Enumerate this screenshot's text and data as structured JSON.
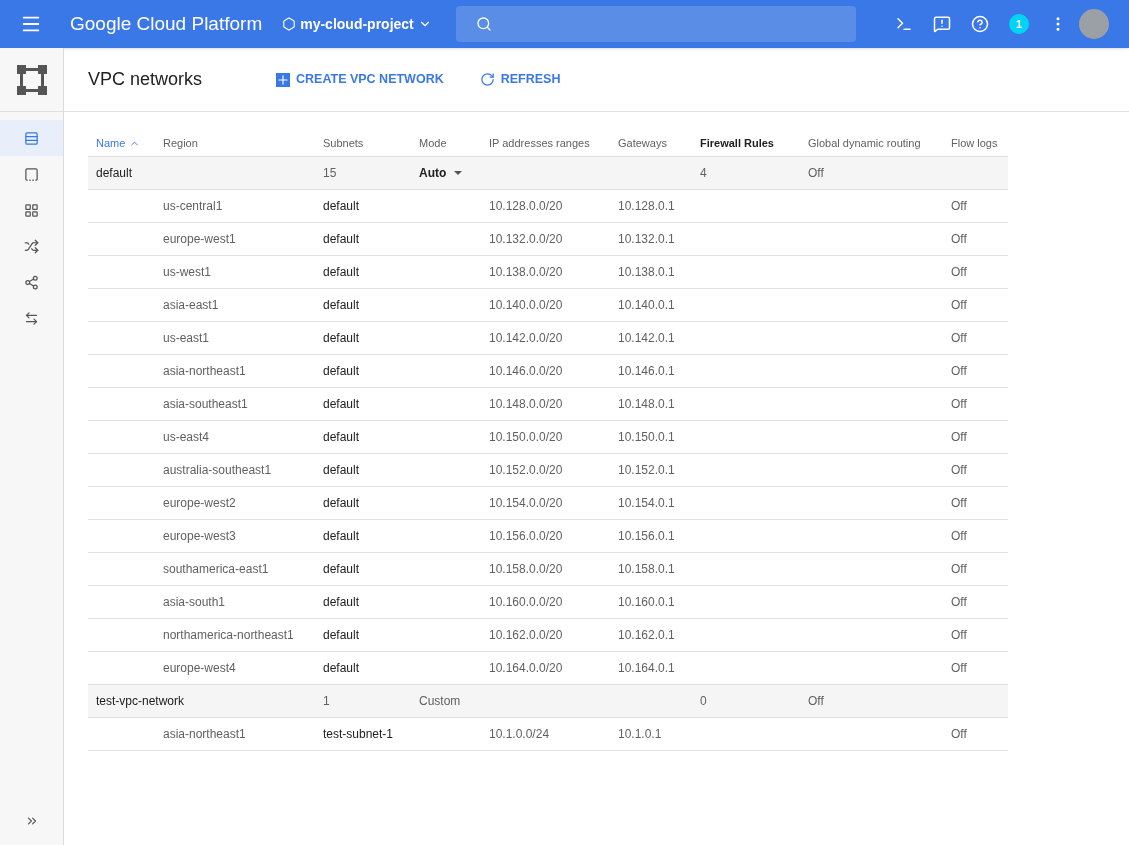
{
  "topbar": {
    "brand": "Google Cloud Platform",
    "project": "my-cloud-project",
    "notifications": "1"
  },
  "sidebar": {
    "items": [
      {
        "selected": true
      },
      {
        "selected": false
      },
      {
        "selected": false
      },
      {
        "selected": false
      },
      {
        "selected": false
      },
      {
        "selected": false
      }
    ]
  },
  "header": {
    "title": "VPC networks",
    "actions": [
      "CREATE VPC NETWORK",
      "REFRESH"
    ]
  },
  "table": {
    "columns": [
      {
        "label": "Name",
        "selected": true,
        "highlighted": false
      },
      {
        "label": "Region",
        "selected": false,
        "highlighted": false
      },
      {
        "label": "Subnets",
        "selected": false,
        "highlighted": false
      },
      {
        "label": "Mode",
        "selected": false,
        "highlighted": false
      },
      {
        "label": "IP addresses ranges",
        "selected": false,
        "highlighted": false
      },
      {
        "label": "Gateways",
        "selected": false,
        "highlighted": false
      },
      {
        "label": "Firewall Rules",
        "selected": false,
        "highlighted": true
      },
      {
        "label": "Global dynamic routing",
        "selected": false,
        "highlighted": false
      },
      {
        "label": "Flow logs",
        "selected": false,
        "highlighted": false
      }
    ],
    "networks": [
      {
        "name": "default",
        "subnets": "15",
        "mode": "Auto",
        "mode_dropdown": true,
        "firewall_rules": "4",
        "dynamic_routing": "Off",
        "children": [
          {
            "region": "us-central1",
            "subnet": "default",
            "ip_range": "10.128.0.0/20",
            "gateway": "10.128.0.1",
            "flow_logs": "Off"
          },
          {
            "region": "europe-west1",
            "subnet": "default",
            "ip_range": "10.132.0.0/20",
            "gateway": "10.132.0.1",
            "flow_logs": "Off"
          },
          {
            "region": "us-west1",
            "subnet": "default",
            "ip_range": "10.138.0.0/20",
            "gateway": "10.138.0.1",
            "flow_logs": "Off"
          },
          {
            "region": "asia-east1",
            "subnet": "default",
            "ip_range": "10.140.0.0/20",
            "gateway": "10.140.0.1",
            "flow_logs": "Off"
          },
          {
            "region": "us-east1",
            "subnet": "default",
            "ip_range": "10.142.0.0/20",
            "gateway": "10.142.0.1",
            "flow_logs": "Off"
          },
          {
            "region": "asia-northeast1",
            "subnet": "default",
            "ip_range": "10.146.0.0/20",
            "gateway": "10.146.0.1",
            "flow_logs": "Off"
          },
          {
            "region": "asia-southeast1",
            "subnet": "default",
            "ip_range": "10.148.0.0/20",
            "gateway": "10.148.0.1",
            "flow_logs": "Off"
          },
          {
            "region": "us-east4",
            "subnet": "default",
            "ip_range": "10.150.0.0/20",
            "gateway": "10.150.0.1",
            "flow_logs": "Off"
          },
          {
            "region": "australia-southeast1",
            "subnet": "default",
            "ip_range": "10.152.0.0/20",
            "gateway": "10.152.0.1",
            "flow_logs": "Off"
          },
          {
            "region": "europe-west2",
            "subnet": "default",
            "ip_range": "10.154.0.0/20",
            "gateway": "10.154.0.1",
            "flow_logs": "Off"
          },
          {
            "region": "europe-west3",
            "subnet": "default",
            "ip_range": "10.156.0.0/20",
            "gateway": "10.156.0.1",
            "flow_logs": "Off"
          },
          {
            "region": "southamerica-east1",
            "subnet": "default",
            "ip_range": "10.158.0.0/20",
            "gateway": "10.158.0.1",
            "flow_logs": "Off"
          },
          {
            "region": "asia-south1",
            "subnet": "default",
            "ip_range": "10.160.0.0/20",
            "gateway": "10.160.0.1",
            "flow_logs": "Off"
          },
          {
            "region": "northamerica-northeast1",
            "subnet": "default",
            "ip_range": "10.162.0.0/20",
            "gateway": "10.162.0.1",
            "flow_logs": "Off"
          },
          {
            "region": "europe-west4",
            "subnet": "default",
            "ip_range": "10.164.0.0/20",
            "gateway": "10.164.0.1",
            "flow_logs": "Off"
          }
        ]
      },
      {
        "name": "test-vpc-network",
        "subnets": "1",
        "mode": "Custom",
        "mode_dropdown": false,
        "firewall_rules": "0",
        "dynamic_routing": "Off",
        "children": [
          {
            "region": "asia-northeast1",
            "subnet": "test-subnet-1",
            "ip_range": "10.1.0.0/24",
            "gateway": "10.1.0.1",
            "flow_logs": "Off"
          }
        ]
      }
    ]
  }
}
